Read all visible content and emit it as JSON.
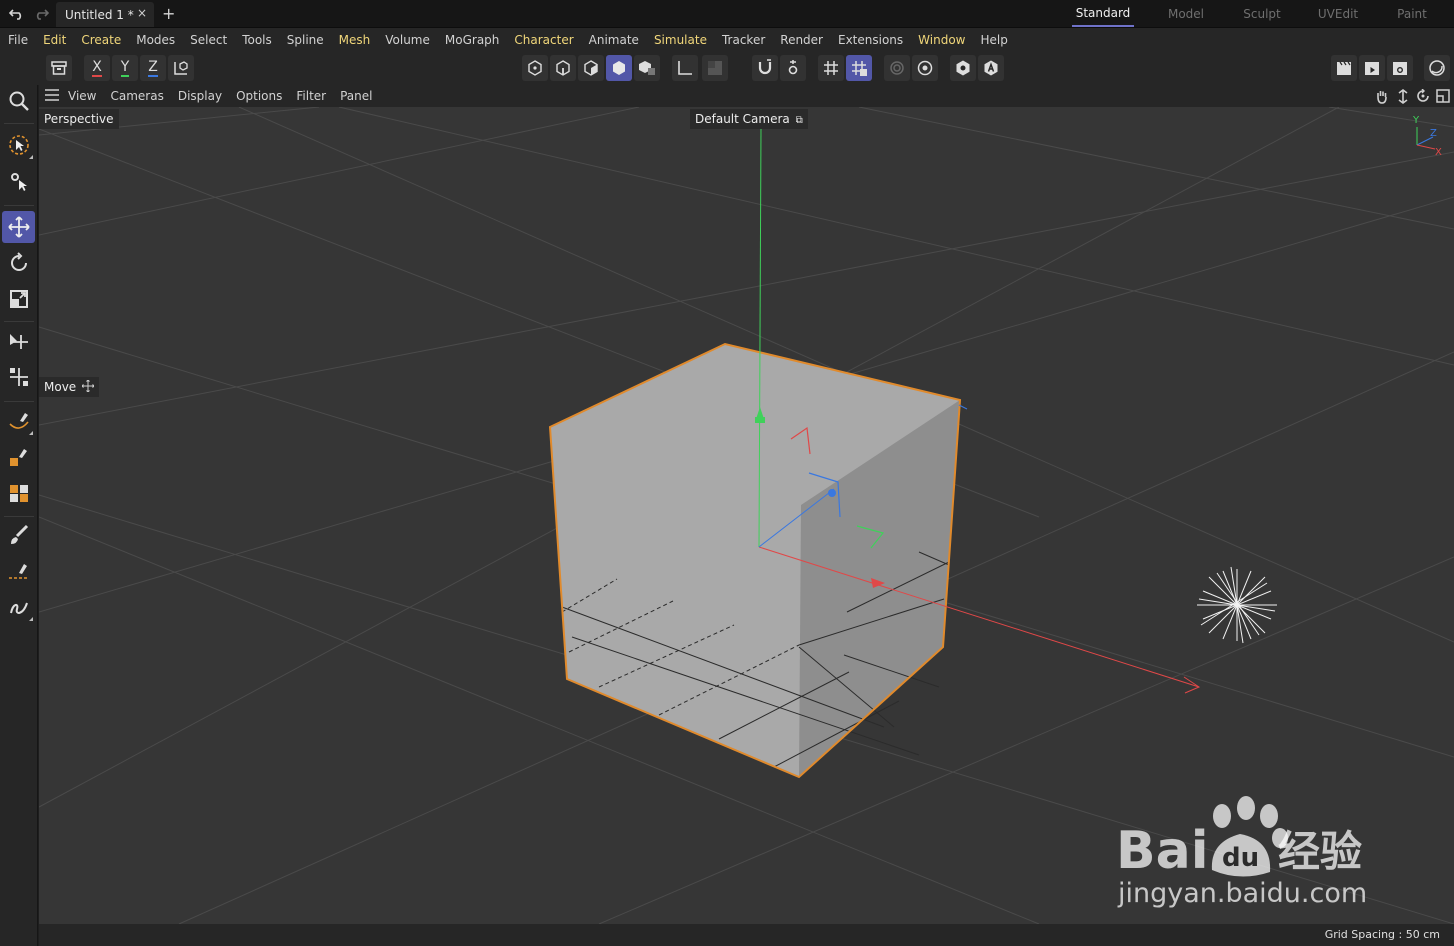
{
  "titlebar": {
    "document_tab": "Untitled 1 *",
    "close_glyph": "×",
    "add_glyph": "+",
    "layouts": [
      "Standard",
      "Model",
      "Sculpt",
      "UVEdit",
      "Paint"
    ],
    "active_layout": "Standard"
  },
  "menubar": {
    "items": [
      "File",
      "Edit",
      "Create",
      "Modes",
      "Select",
      "Tools",
      "Spline",
      "Mesh",
      "Volume",
      "MoGraph",
      "Character",
      "Animate",
      "Simulate",
      "Tracker",
      "Render",
      "Extensions",
      "Window",
      "Help"
    ],
    "highlight_color": "#f0d67a"
  },
  "cmdbar": {
    "axis_x": "X",
    "axis_y": "Y",
    "axis_z": "Z"
  },
  "viewport_menu": {
    "items": [
      "View",
      "Cameras",
      "Display",
      "Options",
      "Filter",
      "Panel"
    ]
  },
  "viewport": {
    "projection": "Perspective",
    "camera": "Default Camera",
    "active_tool": "Move",
    "axis_labels": {
      "x": "X",
      "y": "Y",
      "z": "Z"
    }
  },
  "status": {
    "grid_spacing": "Grid Spacing : 50 cm"
  },
  "watermark": {
    "brand": "Bai",
    "brand2": "du",
    "cn": "经验",
    "url": "jingyan.baidu.com"
  },
  "colors": {
    "accent": "#5257a8",
    "selection_outline": "#e08a2c",
    "axis_x": "#e04848",
    "axis_y": "#3fd15a",
    "axis_z": "#3a78e0",
    "viewport_bg": "#363636"
  }
}
